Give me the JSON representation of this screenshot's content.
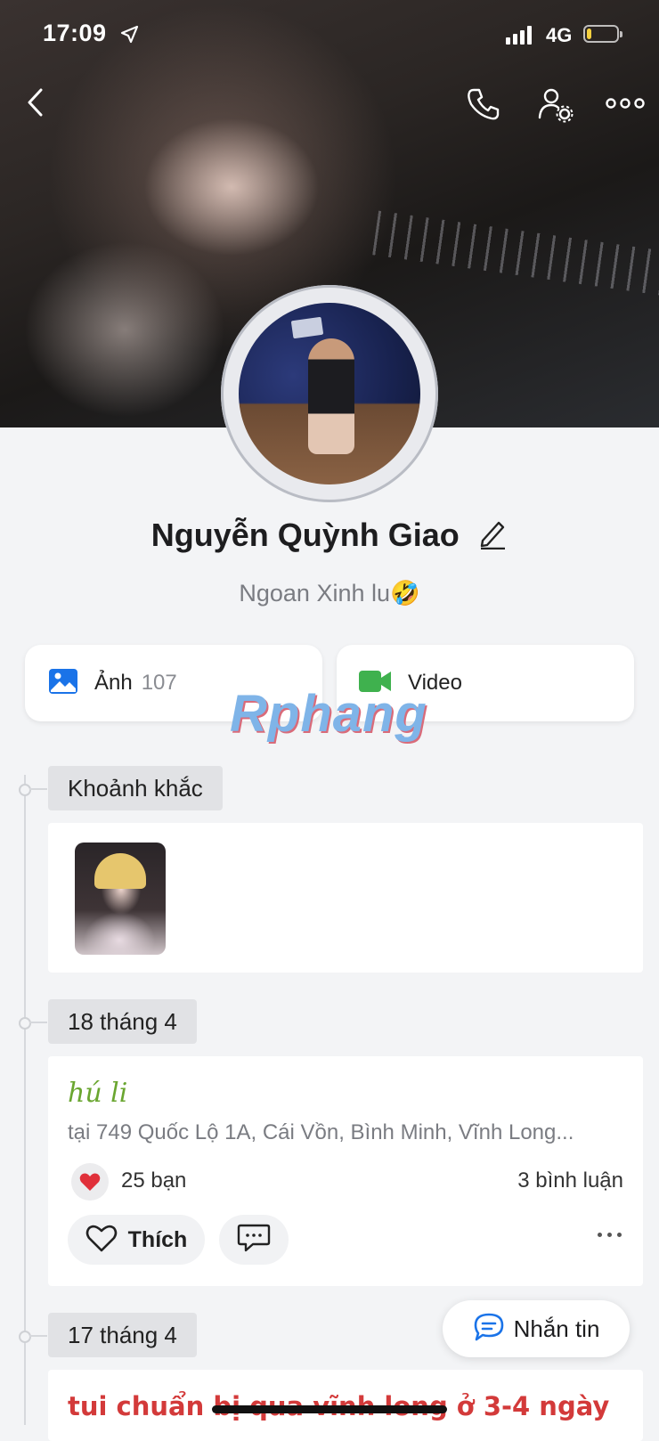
{
  "status_bar": {
    "time": "17:09",
    "network": "4G",
    "battery_level": 0.15
  },
  "profile": {
    "name": "Nguyễn Quỳnh Giao",
    "bio": "Ngoan Xinh lu🤣"
  },
  "media": {
    "photos_label": "Ảnh",
    "photos_count": "107",
    "video_label": "Video"
  },
  "watermark": "Rphang",
  "sections": {
    "moments_label": "Khoảnh khắc",
    "date1": "18 tháng 4",
    "date2": "17 tháng 4"
  },
  "post1": {
    "title": "hú li",
    "location": "tại 749 Quốc Lộ 1A, Cái Vồn, Bình Minh, Vĩnh Long...",
    "likes": "25 bạn",
    "comments": "3 bình luận",
    "like_label": "Thích"
  },
  "post2": {
    "text": "tui chuẩn bị qua vĩnh long ở 3-4 ngày"
  },
  "message_button": {
    "label": "Nhắn tin"
  },
  "colors": {
    "accent_green": "#6aa630",
    "post_red": "#d33a3a",
    "heart": "#e0303a"
  }
}
